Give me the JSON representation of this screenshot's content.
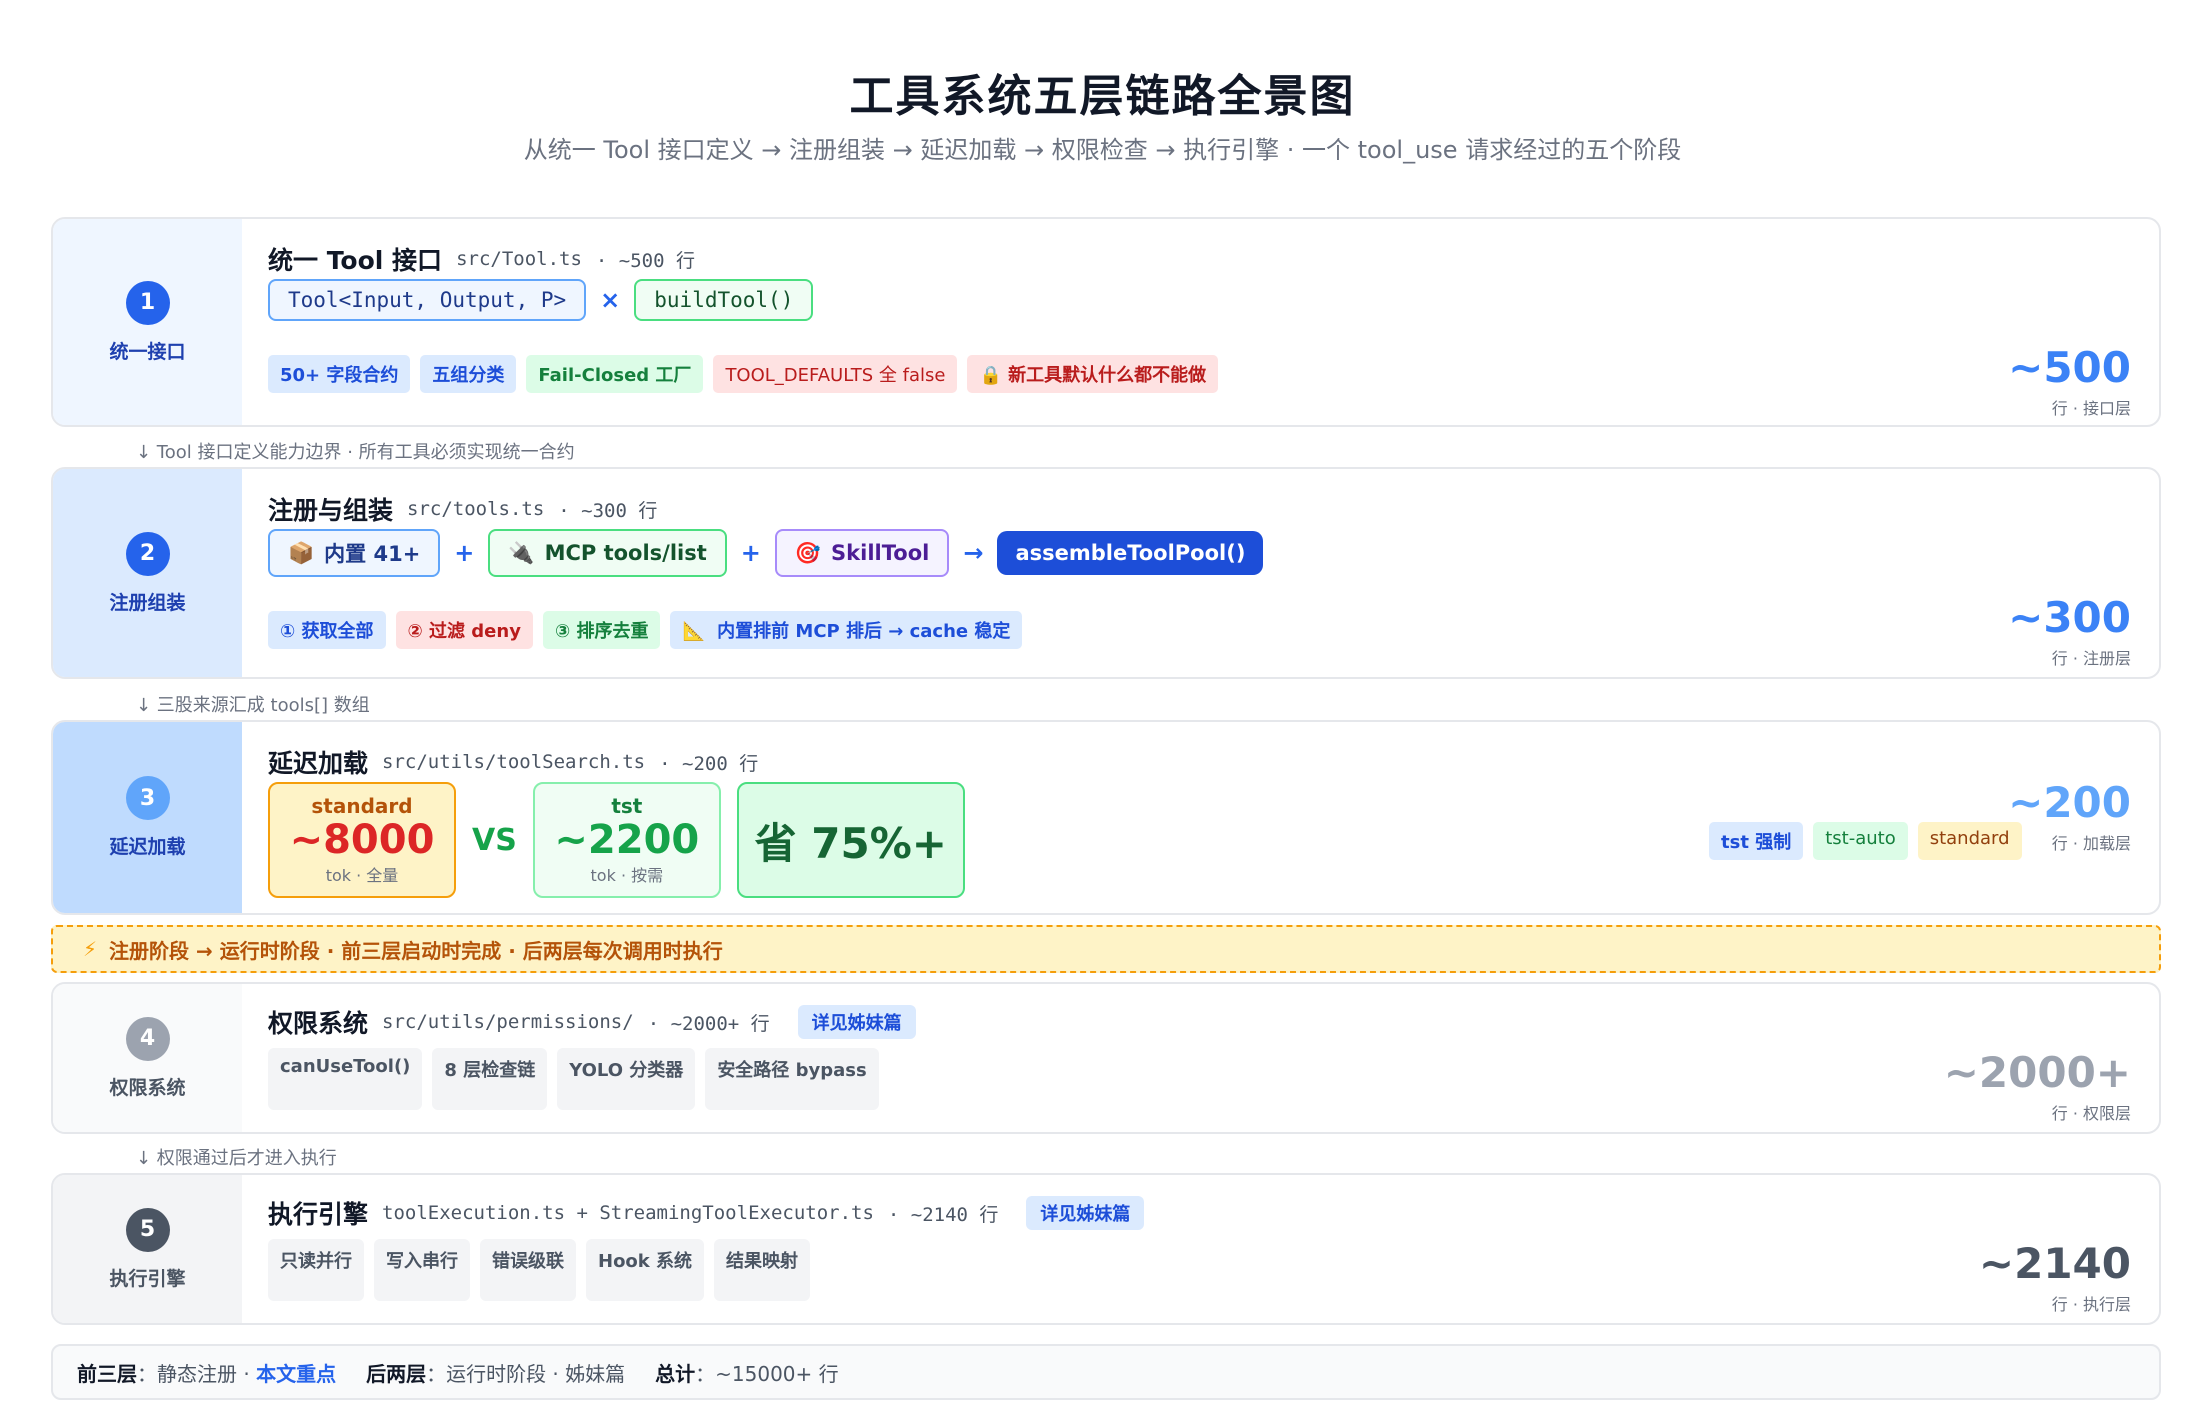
{
  "title": "工具系统五层链路全景图",
  "subtitle": "从统一 Tool 接口定义 → 注册组装 → 延迟加载 → 权限检查 → 执行引擎 · 一个 tool_use 请求经过的五个阶段",
  "colors": {
    "blue": "#2563eb",
    "green": "#16a34a",
    "purple": "#7c3aed",
    "orange": "#ea580c",
    "gray": "#6b7280",
    "banner": "#fef3c7"
  },
  "layer1": {
    "num": "1",
    "side_label": "统一接口",
    "title": "统一 Tool 接口",
    "path": "src/Tool.ts",
    "meta": "· ~500 行",
    "pill_a": "Tool<Input, Output, P>",
    "op": "×",
    "pill_b": "buildTool()",
    "tags": [
      "50+ 字段合约",
      "五组分类",
      "Fail-Closed 工厂",
      "TOOL_DEFAULTS 全 false",
      "新工具默认什么都不能做"
    ],
    "lock_icon": "lock-icon",
    "stat": "~500",
    "stat_sub": "行 · 接口层"
  },
  "conn1": "↓ Tool 接口定义能力边界 · 所有工具必须实现统一合约",
  "layer2": {
    "num": "2",
    "side_label": "注册组装",
    "title": "注册与组装",
    "path": "src/tools.ts",
    "meta": "· ~300 行",
    "builtin": "内置 41+",
    "plus": "+",
    "mcp": "MCP tools/list",
    "skill": "SkillTool",
    "arrow": "→",
    "assemble": "assembleToolPool()",
    "tags": [
      "① 获取全部",
      "② 过滤 deny",
      "③ 排序去重",
      "内置排前 MCP 排后 → cache 稳定"
    ],
    "stat": "~300",
    "stat_sub": "行 · 注册层"
  },
  "conn2": "↓ 三股来源汇成 tools[] 数组",
  "layer3": {
    "num": "3",
    "side_label": "延迟加载",
    "title": "延迟加载",
    "path": "src/utils/toolSearch.ts",
    "meta": "· ~200 行",
    "standard_label": "standard",
    "standard_value": "~8000",
    "standard_sub": "tok · 全量",
    "vs": "VS",
    "tst_label": "tst",
    "tst_value": "~2200",
    "tst_sub": "tok · 按需",
    "save": "省 75%+",
    "tags": [
      "tst 强制",
      "tst-auto",
      "standard"
    ],
    "stat": "~200",
    "stat_sub": "行 · 加载层"
  },
  "banner": {
    "icon": "lightning-icon",
    "text": "注册阶段 → 运行时阶段 · 前三层启动时完成 · 后两层每次调用时执行"
  },
  "layer4": {
    "num": "4",
    "side_label": "权限系统",
    "title": "权限系统",
    "path": "src/utils/permissions/",
    "meta": "· ~2000+ 行",
    "sister": "详见姊妹篇",
    "chips": [
      "canUseTool()",
      "8 层检查链",
      "YOLO 分类器",
      "安全路径 bypass"
    ],
    "stat": "~2000+",
    "stat_sub": "行 · 权限层"
  },
  "conn4": "↓ 权限通过后才进入执行",
  "layer5": {
    "num": "5",
    "side_label": "执行引擎",
    "title": "执行引擎",
    "path": "toolExecution.ts + StreamingToolExecutor.ts",
    "meta": "· ~2140 行",
    "sister": "详见姊妹篇",
    "chips": [
      "只读并行",
      "写入串行",
      "错误级联",
      "Hook 系统",
      "结果映射"
    ],
    "stat": "~2140",
    "stat_sub": "行 · 执行层"
  },
  "footer": {
    "a_label": "前三层",
    "a_text": "：静态注册 · ",
    "a_hl": "本文重点",
    "b_label": "后两层",
    "b_text": "：运行时阶段 · 姊妹篇",
    "c_label": "总计",
    "c_text": "：~15000+ 行"
  }
}
